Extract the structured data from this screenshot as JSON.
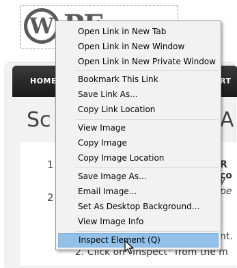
{
  "background": {
    "logo_word": "PF",
    "nav": {
      "home": "HOME",
      "right_fragment": "RT"
    },
    "title_left": "Sc",
    "title_right": "A",
    "list_numbers": [
      "1",
      "2"
    ],
    "fragments": {
      "r_co": "R co",
      "y_pe": "y pe",
      "nt": "nt.",
      "step2": "2. Click on \"Inspect\" from the m"
    }
  },
  "context_menu": {
    "items": [
      {
        "label": "Open Link in New Tab"
      },
      {
        "label": "Open Link in New Window"
      },
      {
        "label": "Open Link in New Private Window"
      },
      {
        "label": "Bookmark This Link"
      },
      {
        "label": "Save Link As..."
      },
      {
        "label": "Copy Link Location"
      },
      {
        "label": "View Image"
      },
      {
        "label": "Copy Image"
      },
      {
        "label": "Copy Image Location"
      },
      {
        "label": "Save Image As..."
      },
      {
        "label": "Email Image..."
      },
      {
        "label": "Set As Desktop Background..."
      },
      {
        "label": "View Image Info"
      },
      {
        "label": "Inspect Element (Q)",
        "highlighted": true
      }
    ],
    "highlight_color": "#92c0e9"
  }
}
